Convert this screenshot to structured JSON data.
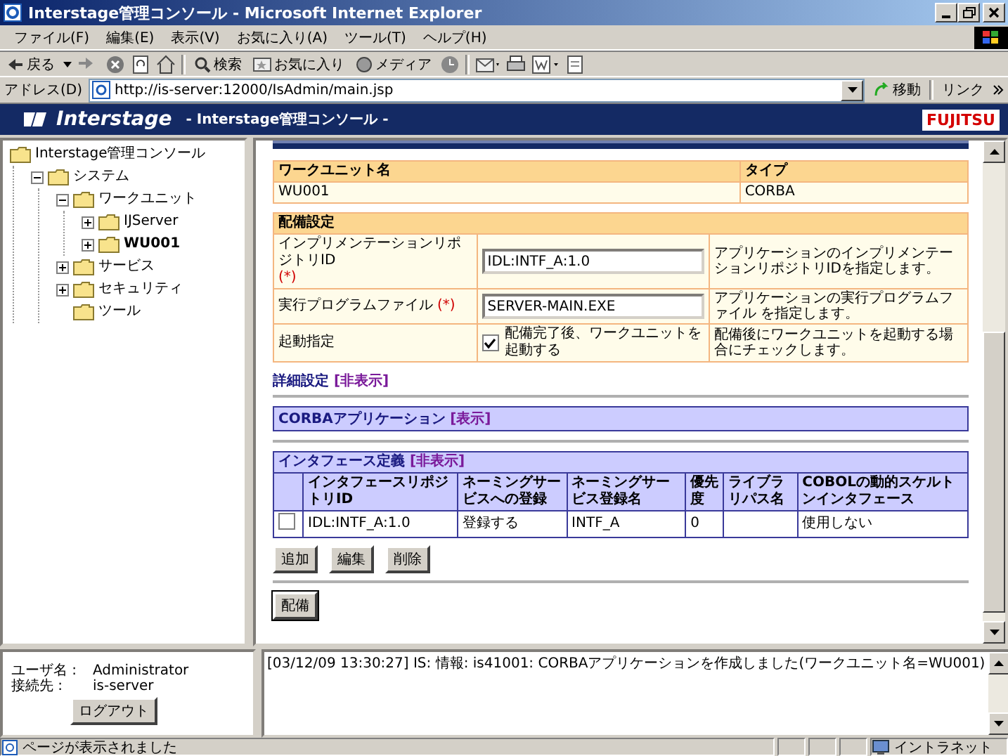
{
  "window": {
    "title": "Interstage管理コンソール - Microsoft Internet Explorer"
  },
  "menu": [
    "ファイル(F)",
    "編集(E)",
    "表示(V)",
    "お気に入り(A)",
    "ツール(T)",
    "ヘルプ(H)"
  ],
  "toolbar": {
    "back": "戻る",
    "search": "検索",
    "favorites": "お気に入り",
    "media": "メディア"
  },
  "address_bar": {
    "label": "アドレス(D)",
    "url": "http://is-server:12000/IsAdmin/main.jsp",
    "go": "移動",
    "links": "リンク"
  },
  "banner": {
    "brand": "Interstage",
    "title": "- Interstage管理コンソール -",
    "logo": "FUJITSU"
  },
  "tree": [
    {
      "label": "Interstage管理コンソール",
      "kind": "root",
      "selected": false,
      "children": [
        {
          "label": "システム",
          "kind": "branch",
          "expanded": true,
          "selected": false,
          "children": [
            {
              "label": "ワークユニット",
              "kind": "branch",
              "expanded": true,
              "selected": false,
              "children": [
                {
                  "label": "IJServer",
                  "kind": "branch",
                  "expanded": false,
                  "selected": false
                },
                {
                  "label": "WU001",
                  "kind": "branch",
                  "expanded": false,
                  "selected": true
                }
              ]
            },
            {
              "label": "サービス",
              "kind": "branch",
              "expanded": false,
              "selected": false
            },
            {
              "label": "セキュリティ",
              "kind": "branch",
              "expanded": false,
              "selected": false
            },
            {
              "label": "ツール",
              "kind": "leaf",
              "selected": false
            }
          ]
        }
      ]
    }
  ],
  "summary": {
    "columns": [
      "ワークユニット名",
      "タイプ"
    ],
    "row": [
      "WU001",
      "CORBA"
    ]
  },
  "deploy": {
    "title": "配備設定",
    "rows": [
      {
        "kind": "text",
        "label": "インプリメンテーションリポジトリID",
        "required_mark": "(*)",
        "value": "IDL:INTF_A:1.0",
        "help": "アプリケーションのインプリメンテーションリポジトリIDを指定します。"
      },
      {
        "kind": "text",
        "label": "実行プログラムファイル",
        "required_mark": "(*)",
        "value": "SERVER-MAIN.EXE",
        "help": "アプリケーションの実行プログラムファイル を指定します。"
      },
      {
        "kind": "checkbox",
        "label": "起動指定",
        "checked": true,
        "option": "配備完了後、ワークユニットを起動する",
        "help": "配備後にワークユニットを起動する場合にチェックします。"
      }
    ]
  },
  "details": {
    "label": "詳細設定",
    "toggle": "[非表示]"
  },
  "corba_section": {
    "title": "CORBAアプリケーション",
    "toggle": "[表示]"
  },
  "interfaces": {
    "title": "インタフェース定義",
    "toggle": "[非表示]",
    "columns": [
      "インタフェースリポジトリID",
      "ネーミングサービスへの登録",
      "ネーミングサービス登録名",
      "優先度",
      "ライブラリパス名",
      "COBOLの動的スケルトンインタフェース"
    ],
    "rows": [
      {
        "checked": false,
        "cells": [
          "IDL:INTF_A:1.0",
          "登録する",
          "INTF_A",
          "0",
          null,
          "使用しない"
        ]
      }
    ],
    "buttons": [
      "追加",
      "編集",
      "削除"
    ]
  },
  "deploy_button": "配備",
  "user": {
    "name_label": "ユーザ名 :",
    "name": "Administrator",
    "host_label": "接続先 :",
    "host": "is-server",
    "logout": "ログアウト"
  },
  "log": "[03/12/09 13:30:27] IS: 情報: is41001: CORBAアプリケーションを作成しました(ワークユニット名=WU001)",
  "status_bar": {
    "message": "ページが表示されました",
    "zone": "イントラネット"
  }
}
